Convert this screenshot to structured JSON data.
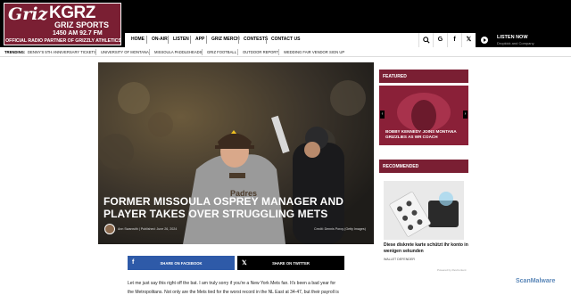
{
  "brand": {
    "griz": "Griz",
    "call": "KGRZ",
    "sports": "GRIZ SPORTS",
    "freq": "1450 AM   92.7 FM",
    "tagline": "OFFICIAL RADIO PARTNER OF GRIZZLY ATHLETICS",
    "color": "#7a1f33"
  },
  "nav": {
    "items": [
      "HOME",
      "ON-AIR",
      "LISTEN",
      "APP",
      "GRIZ MERCH",
      "CONTESTS",
      "CONTACT US"
    ]
  },
  "header_icons": [
    "search-icon",
    "google-icon",
    "facebook-icon",
    "x-icon"
  ],
  "listen": {
    "title": "LISTEN NOW",
    "subtitle": "Dropkick and Company"
  },
  "trending": {
    "label": "TRENDING:",
    "items": [
      "DENNY'S 5TH ANNIVERSARY TICKETS",
      "UNIVERSITY OF MONTANA",
      "MISSOULA PADDLEHEADS",
      "GRIZ FOOTBALL",
      "OUTDOOR REPORT",
      "WEDDING FAIR VENDOR SIGN UP"
    ]
  },
  "article": {
    "title": "FORMER MISSOULA OSPREY MANAGER AND PLAYER TAKES OVER STRUGGLING METS",
    "byline": "Ann Swanwith  |  Published: June 26, 2024",
    "credit": "Credit: Dennis Poroy (Getty Images)",
    "share_facebook": "SHARE ON FACEBOOK",
    "share_twitter": "SHARE ON TWITTER",
    "body": [
      "Let me just say this right off the bat. I am truly sorry if you're a New York Mets fan. It's been a bad year for",
      "the Metropolitans. Not only are the Mets tied for the worst record in the NL East at 34-47, but their payroll is"
    ]
  },
  "sidebar": {
    "featured_label": "FEATURED",
    "featured_title": "BOBBY KENNEDY JOINS MONTANA GRIZZLIES AS WR COACH",
    "recommended_label": "RECOMMENDED",
    "ad_title": "Diese diskrete karte schützt ihr konto in wenigen sekunden",
    "ad_source": "WALLET DEFENDER",
    "ad_powered": "Powered by RevContent"
  },
  "watermark": "ScanMalware"
}
